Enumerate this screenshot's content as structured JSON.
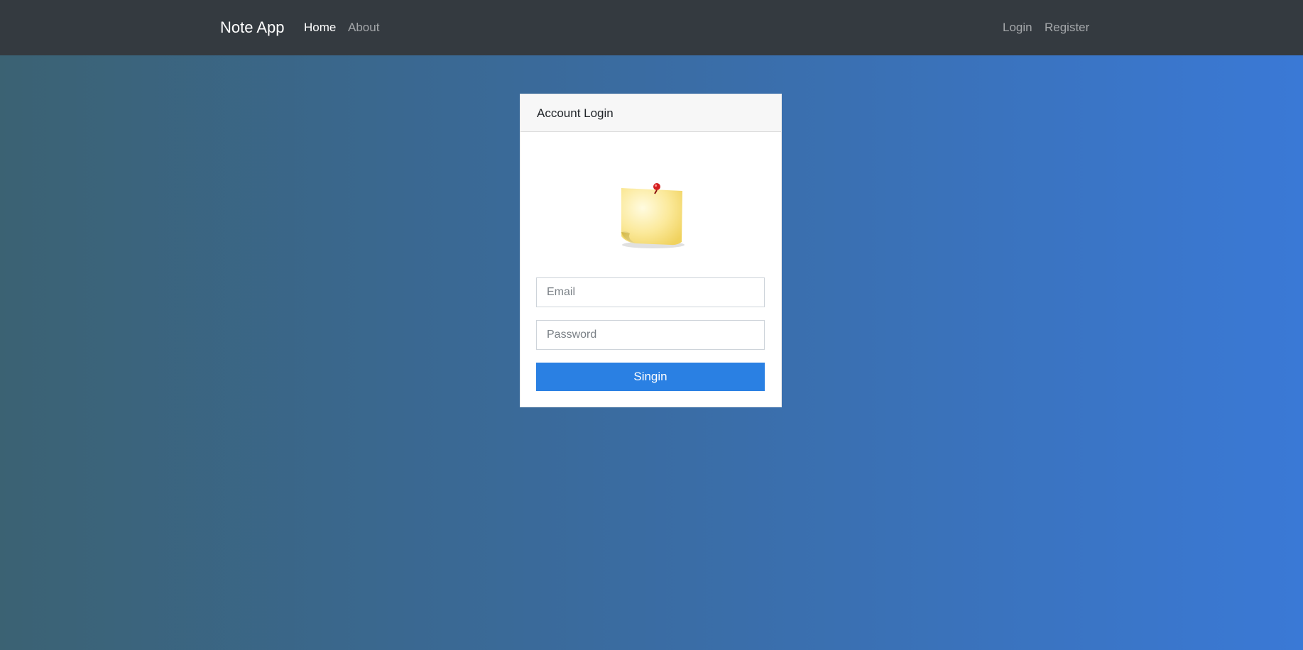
{
  "navbar": {
    "brand": "Note App",
    "left_links": [
      {
        "label": "Home",
        "active": true
      },
      {
        "label": "About",
        "active": false
      }
    ],
    "right_links": [
      {
        "label": "Login"
      },
      {
        "label": "Register"
      }
    ]
  },
  "login_card": {
    "title": "Account Login",
    "image_icon": "sticky-note-icon",
    "email": {
      "placeholder": "Email",
      "value": ""
    },
    "password": {
      "placeholder": "Password",
      "value": ""
    },
    "submit_label": "Singin"
  },
  "colors": {
    "navbar_bg": "#343a40",
    "button_bg": "#2a80e3",
    "gradient_start": "#3b6273",
    "gradient_end": "#3a79d6"
  }
}
